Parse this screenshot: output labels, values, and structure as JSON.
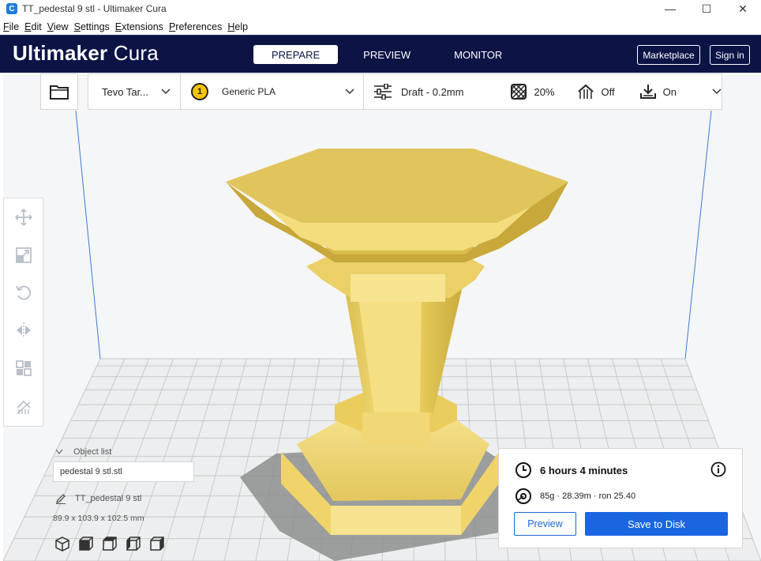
{
  "window": {
    "title": "TT_pedestal 9 stl - Ultimaker Cura",
    "app_icon": "C",
    "minimize": "—",
    "maximize": "☐",
    "close": "✕"
  },
  "menu": [
    {
      "label": "File",
      "accel": "F",
      "rest": "ile"
    },
    {
      "label": "Edit",
      "accel": "E",
      "rest": "dit"
    },
    {
      "label": "View",
      "accel": "V",
      "rest": "iew"
    },
    {
      "label": "Settings",
      "accel": "S",
      "rest": "ettings"
    },
    {
      "label": "Extensions",
      "accel": "E",
      "rest": "xtensions"
    },
    {
      "label": "Preferences",
      "accel": "P",
      "rest": "references"
    },
    {
      "label": "Help",
      "accel": "H",
      "rest": "elp"
    }
  ],
  "header": {
    "brand_bold": "Ultimaker",
    "brand_light": " Cura",
    "tabs": [
      "PREPARE",
      "PREVIEW",
      "MONITOR"
    ],
    "active_tab": "PREPARE",
    "marketplace": "Marketplace",
    "sign_in": "Sign in",
    "bg_color": "#0c1446"
  },
  "toolbar": {
    "printer": "Tevo Tar...",
    "extruder_number": "1",
    "material": "Generic PLA",
    "profile": "Draft - 0.2mm",
    "infill": "20%",
    "support": "Off",
    "adhesion": "On",
    "icons": [
      "folder-icon",
      "chevron-down-icon",
      "settings-sliders-icon",
      "infill-icon",
      "support-icon",
      "adhesion-icon"
    ]
  },
  "tools": [
    "move-icon",
    "scale-icon",
    "rotate-icon",
    "mirror-icon",
    "per-model-settings-icon",
    "support-blocker-icon"
  ],
  "object_list": {
    "toggle_label": "Object list",
    "items": [
      "pedestal 9 stl.stl"
    ],
    "selected_name": "TT_pedestal 9 stl",
    "dimensions": "89.9 x 103.9 x 102.5 mm",
    "view_icons": [
      "3d-view-icon",
      "front-view-icon",
      "top-view-icon",
      "left-view-icon",
      "right-view-icon"
    ]
  },
  "print_summary": {
    "time": "6 hours 4 minutes",
    "material": "85g · 28.39m · ron 25.40",
    "preview_button": "Preview",
    "save_button": "Save to Disk",
    "accent": "#1966e0"
  },
  "colors": {
    "model_yellow": "#f2dc7a",
    "build_plate": "#f5f6f7",
    "grid": "#c8c8c8"
  }
}
